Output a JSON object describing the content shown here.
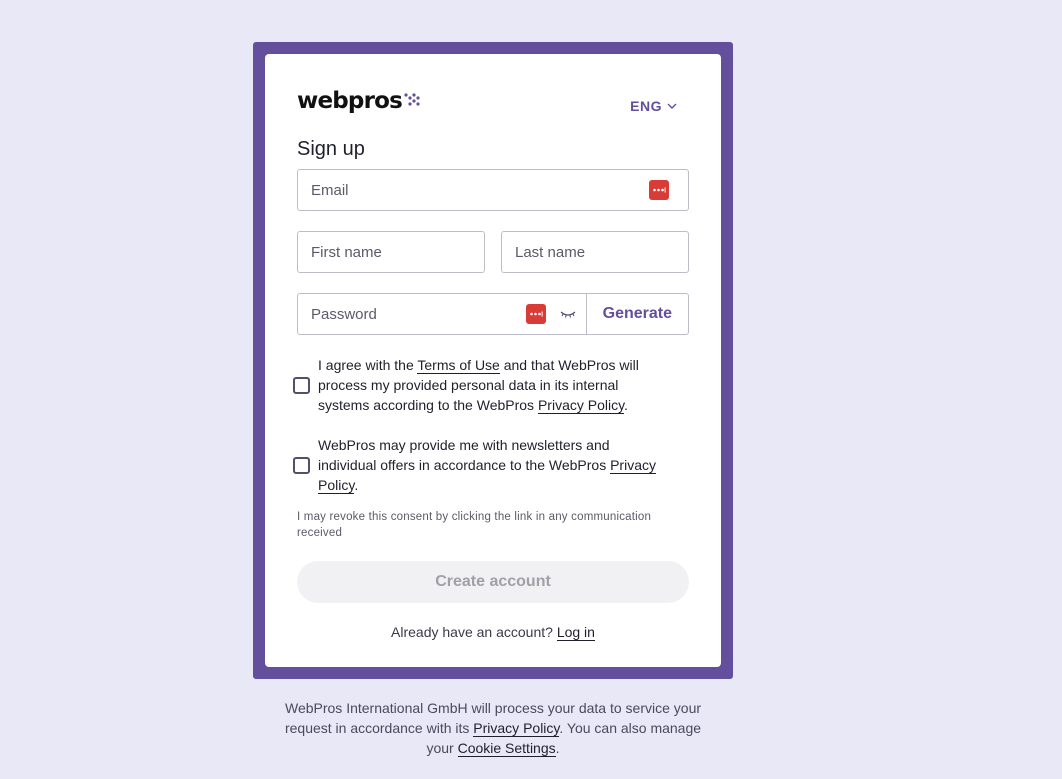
{
  "brand": {
    "logo_text": "webpros"
  },
  "language": {
    "selected": "ENG"
  },
  "form": {
    "title": "Sign up",
    "email_placeholder": "Email",
    "first_name_placeholder": "First name",
    "last_name_placeholder": "Last name",
    "password_placeholder": "Password",
    "generate_label": "Generate",
    "terms": {
      "prefix": "I agree with the ",
      "terms_link": "Terms of Use",
      "middle": " and that WebPros will process my provided personal data in its internal systems according to the WebPros ",
      "privacy_link": "Privacy Policy",
      "suffix": "."
    },
    "newsletter": {
      "prefix": "WebPros may provide me with newsletters and individual offers in accordance to the WebPros ",
      "privacy_link": "Privacy Policy",
      "suffix": "."
    },
    "revoke_note": "I may revoke this consent by clicking the link in any communication received",
    "create_label": "Create account",
    "login_prompt": "Already have an account? ",
    "login_link": "Log in"
  },
  "footer": {
    "prefix": "WebPros International GmbH will process your data to service your request in accordance with its ",
    "privacy_link": "Privacy Policy",
    "middle": ". You can also manage your ",
    "cookie_link": "Cookie Settings",
    "suffix": "."
  },
  "colors": {
    "accent": "#634f9c",
    "background": "#e8e8f7",
    "password_manager": "#d93b37"
  }
}
